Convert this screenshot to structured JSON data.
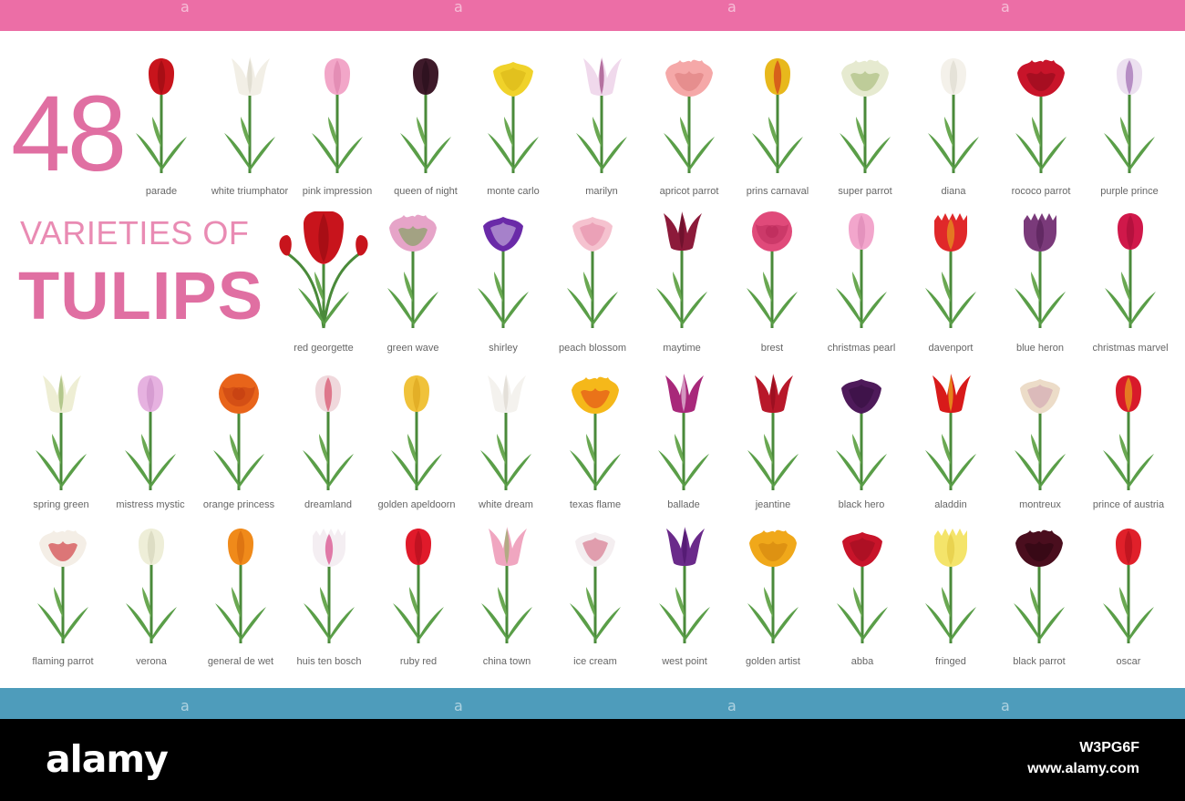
{
  "header": {
    "count": "48",
    "subtitle": "VARIETIES OF",
    "title": "TULIPS"
  },
  "colors": {
    "accent_pink": "#ec6ea6",
    "accent_blue": "#4e9cbb",
    "stem": "#4a8a3a",
    "leaf": "#5a9e48"
  },
  "tulips": [
    {
      "name": "parade",
      "petal": "#c8141c",
      "dark": "#8e0a10",
      "shape": "cup"
    },
    {
      "name": "white triumphator",
      "petal": "#f2efe6",
      "dark": "#d6d2c4",
      "shape": "lily"
    },
    {
      "name": "pink impression",
      "petal": "#f2a6c8",
      "dark": "#d97aa6",
      "shape": "cup"
    },
    {
      "name": "queen of night",
      "petal": "#3e1a2a",
      "dark": "#220c17",
      "shape": "cup"
    },
    {
      "name": "monte carlo",
      "petal": "#f0d22a",
      "dark": "#d1ad0f",
      "shape": "double"
    },
    {
      "name": "marilyn",
      "petal": "#f0d9ec",
      "dark": "#8e2c6e",
      "shape": "lily"
    },
    {
      "name": "apricot parrot",
      "petal": "#f5a8a8",
      "dark": "#d97878",
      "shape": "parrot"
    },
    {
      "name": "prins carnaval",
      "petal": "#e8b81c",
      "dark": "#c81a1a",
      "shape": "cup"
    },
    {
      "name": "super parrot",
      "petal": "#e6ead0",
      "dark": "#9cb26c",
      "shape": "parrot"
    },
    {
      "name": "diana",
      "petal": "#f4f1ea",
      "dark": "#d9d5c9",
      "shape": "cup"
    },
    {
      "name": "rococo parrot",
      "petal": "#c8142a",
      "dark": "#8c0a1a",
      "shape": "parrot"
    },
    {
      "name": "purple prince",
      "petal": "#ece0f0",
      "dark": "#8a4aa0",
      "shape": "cup"
    },
    {
      "name": "red georgette",
      "petal": "#c8141c",
      "dark": "#8e0a10",
      "shape": "bouquet"
    },
    {
      "name": "green wave",
      "petal": "#e6a4c8",
      "dark": "#6ca04a",
      "shape": "parrot"
    },
    {
      "name": "shirley",
      "petal": "#6a2aa8",
      "dark": "#f0ecf4",
      "shape": "double"
    },
    {
      "name": "peach blossom",
      "petal": "#f5c2cf",
      "dark": "#e07a98",
      "shape": "double"
    },
    {
      "name": "maytime",
      "petal": "#8c1a3a",
      "dark": "#5e0c24",
      "shape": "lily"
    },
    {
      "name": "brest",
      "petal": "#e04a7a",
      "dark": "#b82858",
      "shape": "peony"
    },
    {
      "name": "christmas pearl",
      "petal": "#f2a6cc",
      "dark": "#d982b0",
      "shape": "cup"
    },
    {
      "name": "davenport",
      "petal": "#e0282a",
      "dark": "#e8b81c",
      "shape": "fringed"
    },
    {
      "name": "blue heron",
      "petal": "#7a3a7a",
      "dark": "#4e1c50",
      "shape": "fringed"
    },
    {
      "name": "christmas marvel",
      "petal": "#d0184a",
      "dark": "#9e0c34",
      "shape": "cup"
    },
    {
      "name": "spring green",
      "petal": "#eeeed4",
      "dark": "#8cae5c",
      "shape": "lily"
    },
    {
      "name": "mistress mystic",
      "petal": "#e6b2e0",
      "dark": "#c88ac4",
      "shape": "cup"
    },
    {
      "name": "orange princess",
      "petal": "#e8641a",
      "dark": "#c03a10",
      "shape": "peony"
    },
    {
      "name": "dreamland",
      "petal": "#f0d8dc",
      "dark": "#d02a4a",
      "shape": "cup"
    },
    {
      "name": "golden apeldoorn",
      "petal": "#f0c23a",
      "dark": "#d8a018",
      "shape": "cup"
    },
    {
      "name": "white dream",
      "petal": "#f4f2ee",
      "dark": "#d8d4cc",
      "shape": "lily"
    },
    {
      "name": "texas flame",
      "petal": "#f5b81a",
      "dark": "#e03a1a",
      "shape": "parrot"
    },
    {
      "name": "ballade",
      "petal": "#a8287a",
      "dark": "#f0e0ec",
      "shape": "lily"
    },
    {
      "name": "jeantine",
      "petal": "#b8182a",
      "dark": "#8a0c1c",
      "shape": "lily"
    },
    {
      "name": "black hero",
      "petal": "#4e1a5a",
      "dark": "#2e0c38",
      "shape": "double"
    },
    {
      "name": "aladdin",
      "petal": "#d81a1a",
      "dark": "#f0c81c",
      "shape": "lily"
    },
    {
      "name": "montreux",
      "petal": "#ecdcc8",
      "dark": "#c890a8",
      "shape": "double"
    },
    {
      "name": "prince of austria",
      "petal": "#d81a2a",
      "dark": "#f0c81c",
      "shape": "cup"
    },
    {
      "name": "flaming  parrot",
      "petal": "#f4eee6",
      "dark": "#c8141c",
      "shape": "parrot"
    },
    {
      "name": "verona",
      "petal": "#eeeed8",
      "dark": "#cfcfb4",
      "shape": "cup"
    },
    {
      "name": "general de wet",
      "petal": "#f08a1a",
      "dark": "#d0640c",
      "shape": "cup"
    },
    {
      "name": "huis ten bosch",
      "petal": "#f4eef2",
      "dark": "#d01a6a",
      "shape": "fringed"
    },
    {
      "name": "ruby red",
      "petal": "#e01a2a",
      "dark": "#a80c1a",
      "shape": "cup"
    },
    {
      "name": "china town",
      "petal": "#f0a6c0",
      "dark": "#8aae5c",
      "shape": "lily"
    },
    {
      "name": "ice cream",
      "petal": "#f4eef0",
      "dark": "#c83a5a",
      "shape": "double"
    },
    {
      "name": "west point",
      "petal": "#6a2a8a",
      "dark": "#4a1468",
      "shape": "lily"
    },
    {
      "name": "golden artist",
      "petal": "#f0a81a",
      "dark": "#d0800c",
      "shape": "parrot"
    },
    {
      "name": "abba",
      "petal": "#c8142a",
      "dark": "#8e0a1c",
      "shape": "double"
    },
    {
      "name": "fringed",
      "petal": "#f4e46a",
      "dark": "#e0c43a",
      "shape": "fringed"
    },
    {
      "name": "black parrot",
      "petal": "#4a0e1e",
      "dark": "#2a0610",
      "shape": "parrot"
    },
    {
      "name": "oscar",
      "petal": "#e0202a",
      "dark": "#a80c18",
      "shape": "cup"
    }
  ],
  "footer": {
    "logo": "alamy",
    "image_id": "W3PG6F",
    "url": "www.alamy.com"
  }
}
